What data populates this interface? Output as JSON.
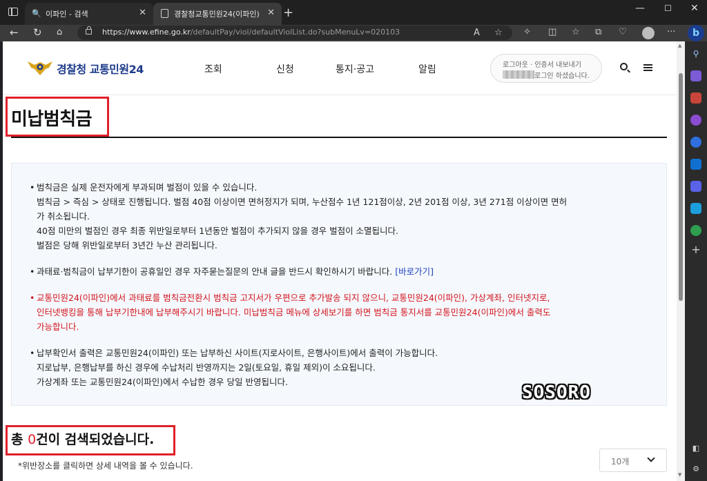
{
  "browser": {
    "tabs": [
      {
        "label": "이파인 - 검색"
      },
      {
        "label": "경찰청교통민원24(이파인)"
      }
    ],
    "url_host": "https://www.efine.go.kr",
    "url_path": "/defaultPay/viol/defaultViolList.do?subMenuLv=020103",
    "bing_label": "b"
  },
  "header": {
    "logo_text": "경찰청 교통민원24",
    "nav": [
      "조회",
      "신청",
      "통지·공고",
      "알림"
    ],
    "login_line1": "로그아웃 · 인증서 내보내기",
    "login_line2": "로그인 하셨습니다."
  },
  "page": {
    "title": "미납범칙금",
    "notices": [
      {
        "lines": [
          "범칙금은 실제 운전자에게 부과되며 벌점이 있을 수 있습니다.",
          "범칙금 > 즉심 > 상태로 진행됩니다. 벌점 40점 이상이면 면허정지가 되며, 누산점수 1년 121점이상, 2년 201점 이상, 3년 271점 이상이면 면허",
          "가 취소됩니다.",
          "40점 미만의 벌점인 경우 최종 위반일로부터 1년동안 벌점이 추가되지 않을 경우 벌점이 소멸됩니다.",
          "벌점은 당해 위반일로부터 3년간 누산 관리됩니다."
        ]
      },
      {
        "text": "과태료·범칙금이 납부기한이 공휴일인 경우 자주묻는질문의 안내 글을 반드시 확인하시기 바랍니다.",
        "link": "[바로가기]"
      },
      {
        "lines": [
          "교통민원24(이파인)에서 과태료를 범칙금전환시 범칙금 고지서가 우편으로 추가발송 되지 않으니, 교통민원24(이파인), 가상계좌, 인터넷지로,",
          "인터넷뱅킹을 통해 납부기한내에 납부해주시기 바랍니다. 미납범칙금 메뉴에 상세보기를 하면 범칙금 통지서를 교통민원24(이파인)에서 출력도",
          "가능합니다."
        ]
      },
      {
        "lines": [
          "납부확인서 출력은 교통민원24(이파인) 또는 납부하신 사이트(지로사이트, 은행사이트)에서 출력이 가능합니다.",
          "지로납부, 은행납부를 하신 경우에 수납처리 반영까지는 2일(토요일, 휴일 제외)이 소요됩니다.",
          "가상계좌 또는 교통민원24(이파인)에서 수납한 경우 당일 반영됩니다."
        ]
      }
    ],
    "watermark": "SOSORO",
    "result_prefix": "총 ",
    "result_count": "0",
    "result_suffix": "건이 검색되었습니다.",
    "result_hint": "*위반장소를 클릭하면 상세 내역을 볼 수 있습니다.",
    "page_size": "10개"
  },
  "colors": {
    "highlight_red": "#e0202a",
    "notice_red": "#d3141d",
    "link_blue": "#1b3fb8",
    "logo_blue": "#1d3a8a"
  }
}
